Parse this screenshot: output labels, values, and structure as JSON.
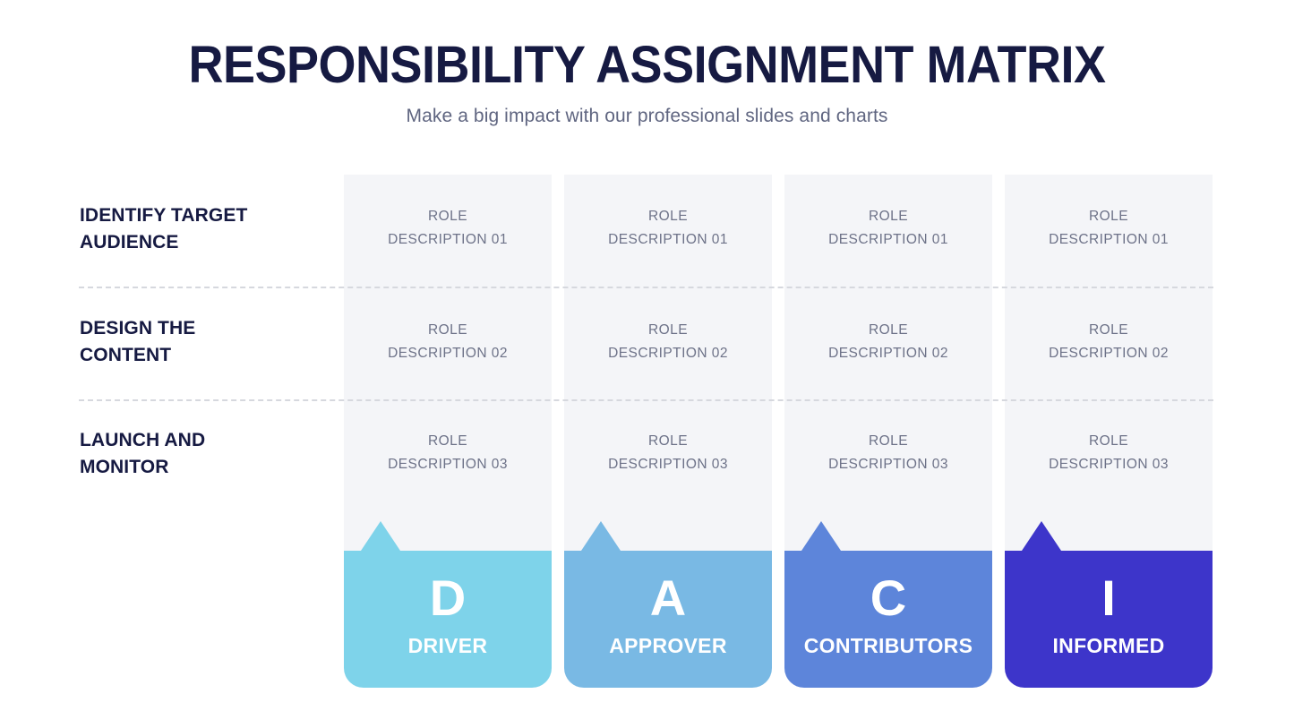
{
  "header": {
    "title": "RESPONSIBILITY ASSIGNMENT MATRIX",
    "subtitle": "Make a big impact with our professional slides and charts"
  },
  "rows": [
    {
      "label_line1": "IDENTIFY TARGET",
      "label_line2": "AUDIENCE"
    },
    {
      "label_line1": "DESIGN THE",
      "label_line2": "CONTENT"
    },
    {
      "label_line1": "LAUNCH AND",
      "label_line2": "MONITOR"
    }
  ],
  "columns": [
    {
      "letter": "D",
      "label": "DRIVER",
      "color": "#7ed3ea",
      "cells": [
        {
          "line1": "ROLE",
          "line2": "DESCRIPTION 01"
        },
        {
          "line1": "ROLE",
          "line2": "DESCRIPTION 02"
        },
        {
          "line1": "ROLE",
          "line2": "DESCRIPTION 03"
        }
      ]
    },
    {
      "letter": "A",
      "label": "APPROVER",
      "color": "#79b9e4",
      "cells": [
        {
          "line1": "ROLE",
          "line2": "DESCRIPTION 01"
        },
        {
          "line1": "ROLE",
          "line2": "DESCRIPTION 02"
        },
        {
          "line1": "ROLE",
          "line2": "DESCRIPTION 03"
        }
      ]
    },
    {
      "letter": "C",
      "label": "CONTRIBUTORS",
      "color": "#5d85da",
      "cells": [
        {
          "line1": "ROLE",
          "line2": "DESCRIPTION 01"
        },
        {
          "line1": "ROLE",
          "line2": "DESCRIPTION 02"
        },
        {
          "line1": "ROLE",
          "line2": "DESCRIPTION 03"
        }
      ]
    },
    {
      "letter": "I",
      "label": "INFORMED",
      "color": "#3d35ca",
      "cells": [
        {
          "line1": "ROLE",
          "line2": "DESCRIPTION 01"
        },
        {
          "line1": "ROLE",
          "line2": "DESCRIPTION 02"
        },
        {
          "line1": "ROLE",
          "line2": "DESCRIPTION 03"
        }
      ]
    }
  ],
  "theme": {
    "background": "#ffffff",
    "panel": "#f4f5f8",
    "heading_color": "#161a42",
    "body_color": "#6d7288",
    "divider_color": "#d6d8de"
  }
}
